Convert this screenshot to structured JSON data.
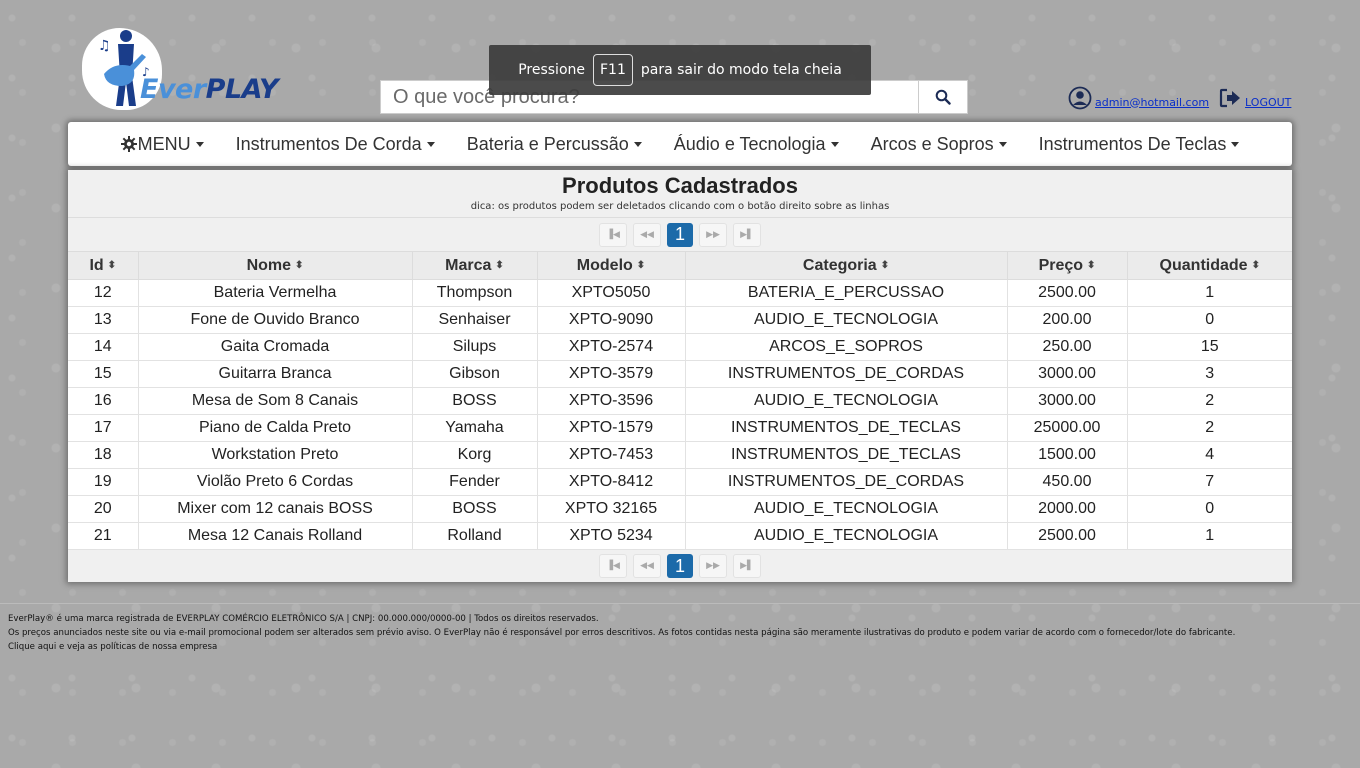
{
  "header": {
    "logo_text_a": "Ever",
    "logo_text_b": "PLAY",
    "search_placeholder": "O que você procura?",
    "user_email": "admin@hotmail.com",
    "logout_label": "LOGOUT"
  },
  "toast": {
    "before": "Pressione",
    "key": "F11",
    "after": "para sair do modo tela cheia"
  },
  "nav": {
    "items": [
      {
        "label": "MENU",
        "icon": "gear-icon"
      },
      {
        "label": "Instrumentos De Corda"
      },
      {
        "label": "Bateria e Percussão"
      },
      {
        "label": "Áudio e Tecnologia"
      },
      {
        "label": "Arcos e Sopros"
      },
      {
        "label": "Instrumentos De Teclas"
      }
    ]
  },
  "panel": {
    "title": "Produtos Cadastrados",
    "hint": "dica: os produtos podem ser deletados clicando com o botão direito sobre as linhas",
    "current_page": "1",
    "columns": [
      "Id",
      "Nome",
      "Marca",
      "Modelo",
      "Categoria",
      "Preço",
      "Quantidade"
    ],
    "rows": [
      [
        "12",
        "Bateria Vermelha",
        "Thompson",
        "XPTO5050",
        "BATERIA_E_PERCUSSAO",
        "2500.00",
        "1"
      ],
      [
        "13",
        "Fone de Ouvido Branco",
        "Senhaiser",
        "XPTO-9090",
        "AUDIO_E_TECNOLOGIA",
        "200.00",
        "0"
      ],
      [
        "14",
        "Gaita Cromada",
        "Silups",
        "XPTO-2574",
        "ARCOS_E_SOPROS",
        "250.00",
        "15"
      ],
      [
        "15",
        "Guitarra Branca",
        "Gibson",
        "XPTO-3579",
        "INSTRUMENTOS_DE_CORDAS",
        "3000.00",
        "3"
      ],
      [
        "16",
        "Mesa de Som 8 Canais",
        "BOSS",
        "XPTO-3596",
        "AUDIO_E_TECNOLOGIA",
        "3000.00",
        "2"
      ],
      [
        "17",
        "Piano de Calda Preto",
        "Yamaha",
        "XPTO-1579",
        "INSTRUMENTOS_DE_TECLAS",
        "25000.00",
        "2"
      ],
      [
        "18",
        "Workstation Preto",
        "Korg",
        "XPTO-7453",
        "INSTRUMENTOS_DE_TECLAS",
        "1500.00",
        "4"
      ],
      [
        "19",
        "Violão Preto 6 Cordas",
        "Fender",
        "XPTO-8412",
        "INSTRUMENTOS_DE_CORDAS",
        "450.00",
        "7"
      ],
      [
        "20",
        "Mixer com 12 canais BOSS",
        "BOSS",
        "XPTO 32165",
        "AUDIO_E_TECNOLOGIA",
        "2000.00",
        "0"
      ],
      [
        "21",
        "Mesa 12 Canais Rolland",
        "Rolland",
        "XPTO 5234",
        "AUDIO_E_TECNOLOGIA",
        "2500.00",
        "1"
      ]
    ]
  },
  "footer": {
    "line1": "EverPlay® é uma marca registrada de EVERPLAY COMÉRCIO ELETRÔNICO S/A | CNPJ: 00.000.000/0000-00 | Todos os direitos reservados.",
    "line2": "Os preços anunciados neste site ou via e-mail promocional podem ser alterados sem prévio aviso. O EverPlay não é responsável por erros descritivos. As fotos contidas nesta página são meramente ilustrativas do produto e podem variar de acordo com o fornecedor/lote do fabricante.",
    "line3": "Clique aqui e veja as políticas de nossa empresa"
  },
  "colors": {
    "accent": "#1c6aa9",
    "link": "#0a2fc9",
    "logo_light": "#4a90d9",
    "logo_dark": "#1a3d8a"
  }
}
